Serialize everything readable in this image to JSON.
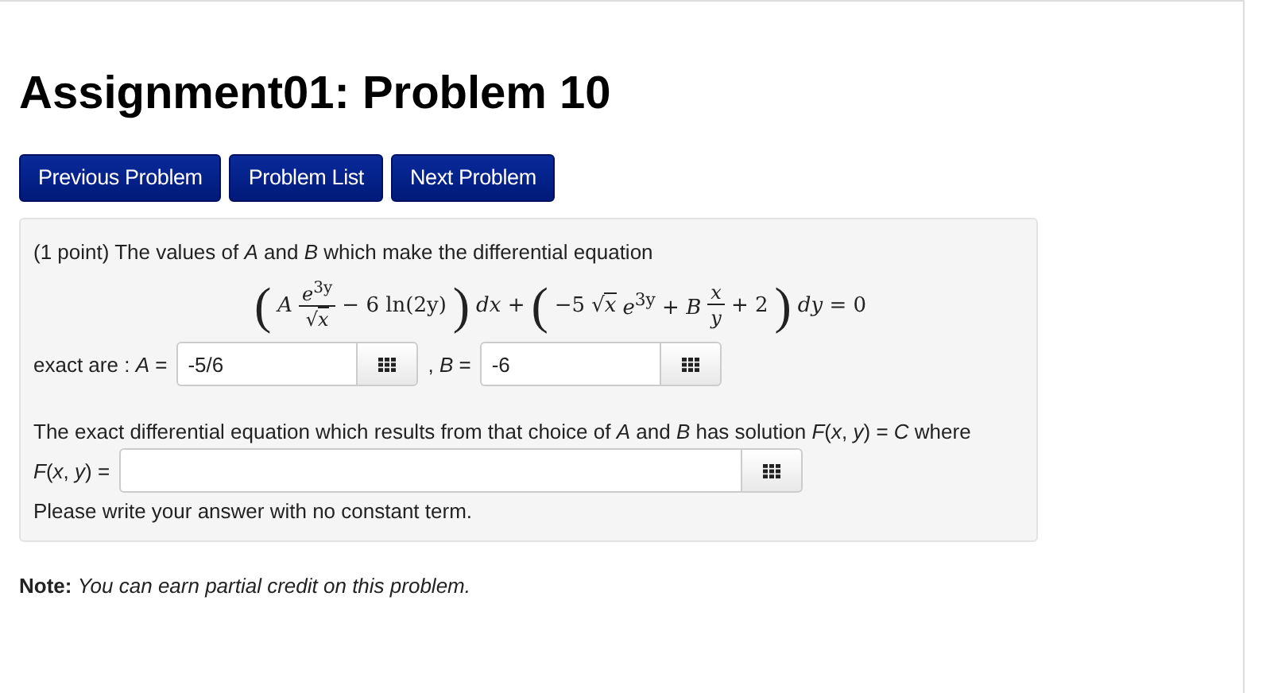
{
  "title": "Assignment01: Problem 10",
  "nav_buttons": [
    "Previous Problem",
    "Problem List",
    "Next Problem"
  ],
  "problem": {
    "intro": "(1 point) The values of *A* and *B* which make the differential equation",
    "equation": [
      {
        "kind": "big",
        "s": "("
      },
      {
        "kind": "text",
        "s": "*A*"
      },
      {
        "kind": "frac",
        "num": "*e*$^{3y}$",
        "den_sign": "√",
        "den": "*x*"
      },
      {
        "kind": "text",
        "s": "− 6 ln(2y)"
      },
      {
        "kind": "big",
        "s": ")"
      },
      {
        "kind": "text",
        "s": "*dx* +"
      },
      {
        "kind": "big",
        "s": "("
      },
      {
        "kind": "text",
        "s": "−5"
      },
      {
        "kind": "sqrt",
        "sign": "√",
        "s": "*x*"
      },
      {
        "kind": "text",
        "s": "*e*$^{3y}$ + *B*"
      },
      {
        "kind": "frac",
        "num": "*x*",
        "den": "*y*"
      },
      {
        "kind": "text",
        "s": "+ 2"
      },
      {
        "kind": "big",
        "s": ")"
      },
      {
        "kind": "text",
        "s": "*dy* = 0"
      }
    ],
    "exact_label": "exact are : *A* =",
    "a_value": "-5/6",
    "b_label": ", *B* =",
    "b_value": "-6",
    "solution_text": "The exact differential equation which results from that choice of *A* and *B* has solution *F*(*x*, *y*) = *C* where",
    "f_label": "*F*(*x*, *y*) =",
    "hint": "Please write your answer with no constant term."
  },
  "note": {
    "label": "Note:",
    "text": "You can earn partial credit on this problem."
  }
}
